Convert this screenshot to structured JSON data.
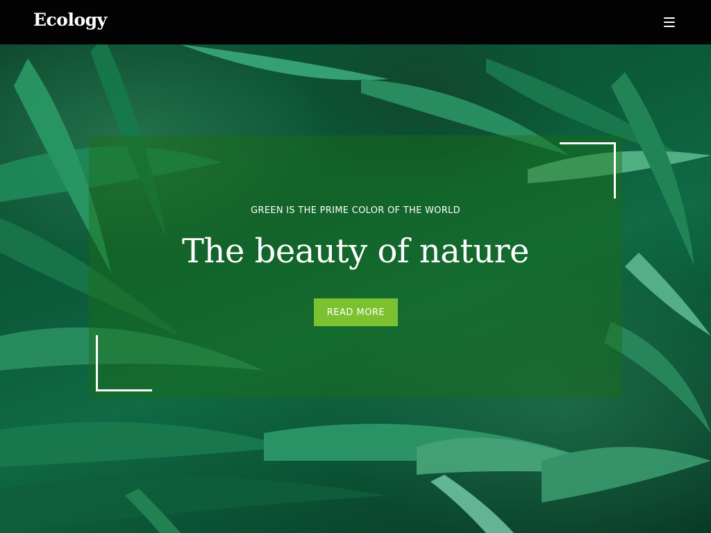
{
  "header": {
    "brand": "Ecology",
    "menu_icon": "hamburger-menu-icon"
  },
  "hero": {
    "eyebrow": "GREEN IS THE PRIME COLOR OF THE WORLD",
    "title": "The beauty of nature",
    "cta_label": "READ MORE",
    "background_image": "green-foliage-leaves"
  },
  "colors": {
    "header_bg": "#030303",
    "accent": "#7cc230",
    "panel_overlay": "#1c6e14",
    "text": "#ffffff"
  }
}
